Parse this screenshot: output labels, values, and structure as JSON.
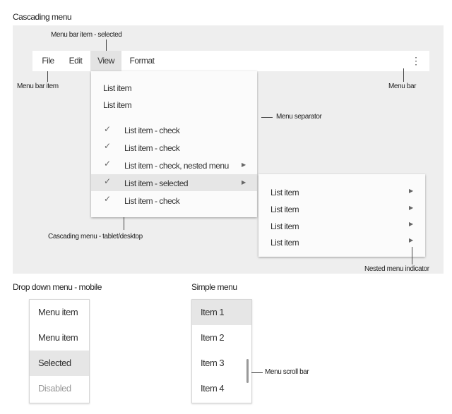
{
  "titles": {
    "cascading": "Cascading menu",
    "dropdown": "Drop down menu - mobile",
    "simple": "Simple menu"
  },
  "annotations": {
    "menubar_selected": "Menu bar item - selected",
    "menubar_item": "Menu bar item",
    "menubar": "Menu bar",
    "separator": "Menu separator",
    "cascading_caption": "Cascading menu - tablet/desktop",
    "nested_indicator": "Nested menu indicator",
    "scroll_bar": "Menu scroll bar"
  },
  "menubar": {
    "items": [
      "File",
      "Edit",
      "View",
      "Format"
    ],
    "selected_index": 2,
    "overflow_icon": "vertical-ellipsis-icon"
  },
  "cascade": {
    "plain": [
      "List item",
      "List item"
    ],
    "checked": [
      {
        "label": "List item - check",
        "checked": true,
        "nested": false,
        "selected": false
      },
      {
        "label": "List item - check",
        "checked": true,
        "nested": false,
        "selected": false
      },
      {
        "label": "List item - check, nested menu",
        "checked": true,
        "nested": true,
        "selected": false
      },
      {
        "label": "List item - selected",
        "checked": true,
        "nested": true,
        "selected": true
      },
      {
        "label": "List item - check",
        "checked": true,
        "nested": false,
        "selected": false
      }
    ],
    "nested": [
      "List item",
      "List item",
      "List item",
      "List item"
    ]
  },
  "dropdown": {
    "items": [
      {
        "label": "Menu item",
        "state": "normal"
      },
      {
        "label": "Menu item",
        "state": "normal"
      },
      {
        "label": "Selected",
        "state": "selected"
      },
      {
        "label": "Disabled",
        "state": "disabled"
      }
    ]
  },
  "simple": {
    "items": [
      {
        "label": "Item 1",
        "state": "selected"
      },
      {
        "label": "Item 2",
        "state": "normal"
      },
      {
        "label": "Item 3",
        "state": "normal"
      },
      {
        "label": "Item 4",
        "state": "normal"
      }
    ]
  },
  "colors": {
    "panel": "#eeeeee",
    "selected": "#e6e6e6",
    "disabled_text": "#999999"
  }
}
